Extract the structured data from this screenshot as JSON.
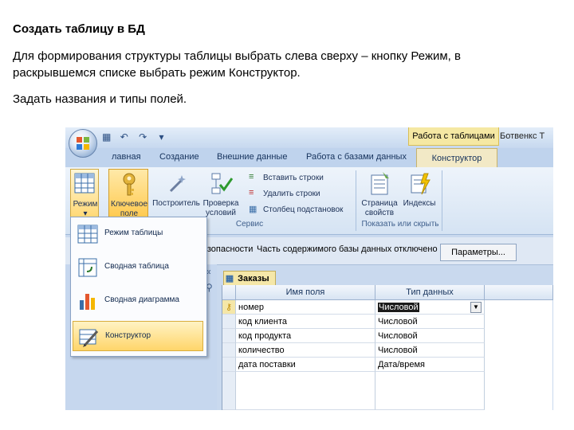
{
  "slide": {
    "title": "Создать таблицу в БД",
    "paragraph1": "Для формирования структуры таблицы  выбрать слева сверху – кнопку Режим, в раскрывшемся списке выбрать режим  Конструктор.",
    "paragraph2": "Задать названия и типы полей."
  },
  "window": {
    "context_tab_group": "Работа с таблицами",
    "context_tab_group_2": "Ботвенкс Т"
  },
  "tabs": [
    "лавная",
    "Создание",
    "Внешние данные",
    "Работа с базами данных"
  ],
  "active_tab": "Конструктор",
  "ribbon": {
    "mode_button": "Режим",
    "key_field_line1": "Ключевое",
    "key_field_line2": "поле",
    "builder": "Построитель",
    "check_line1": "Проверка",
    "check_line2": "условий",
    "insert_rows": "Вставить строки",
    "delete_rows": "Удалить строки",
    "lookup_column": "Столбец подстановок",
    "group_service": "Сервис",
    "property_sheet_line1": "Страница",
    "property_sheet_line2": "свойств",
    "indexes": "Индексы",
    "group_show_hide": "Показать или скрыть"
  },
  "message_bar": {
    "text_fragment": "езопасности",
    "message": "Часть содержимого базы данных отключено",
    "params_button": "Параметры..."
  },
  "nav": {
    "collapse": "«"
  },
  "menu": {
    "items": [
      "Режим таблицы",
      "Сводная таблица",
      "Сводная диаграмма",
      "Конструктор"
    ]
  },
  "table": {
    "tab_title": "Заказы",
    "col_field": "Имя поля",
    "col_type": "Тип данных",
    "rows": [
      {
        "name": "номер",
        "type": "Числовой"
      },
      {
        "name": "код клиента",
        "type": "Числовой"
      },
      {
        "name": "код продукта",
        "type": "Числовой"
      },
      {
        "name": "количество",
        "type": "Числовой"
      },
      {
        "name": "дата поставки",
        "type": "Дата/время"
      }
    ]
  },
  "colors": {
    "accent_yellow": "#ffd56a",
    "ribbon_blue": "#d5e3f3"
  }
}
